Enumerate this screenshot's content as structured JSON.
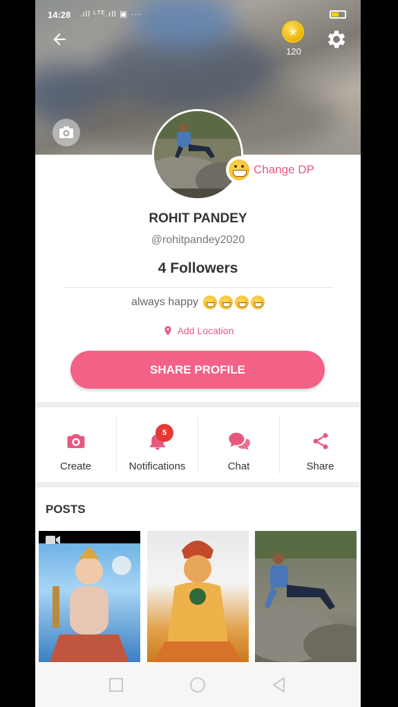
{
  "status_bar": {
    "time": "14:28",
    "signal": ".ıll ᴸᵀᴱ.ıll ▣ ···"
  },
  "header": {
    "coin_count": "120"
  },
  "profile": {
    "change_dp_label": "Change DP",
    "name": "ROHIT PANDEY",
    "handle": "@rohitpandey2020",
    "followers": "4 Followers",
    "bio": "always happy",
    "add_location": "Add Location",
    "share_profile": "SHARE PROFILE"
  },
  "actions": [
    {
      "label": "Create",
      "icon": "camera-icon"
    },
    {
      "label": "Notifications",
      "icon": "bell-icon",
      "badge": "5"
    },
    {
      "label": "Chat",
      "icon": "chat-icon"
    },
    {
      "label": "Share",
      "icon": "share-icon"
    }
  ],
  "posts": {
    "title": "POSTS"
  },
  "colors": {
    "accent": "#f36186",
    "accent_text": "#e8577f",
    "badge": "#e53935"
  }
}
